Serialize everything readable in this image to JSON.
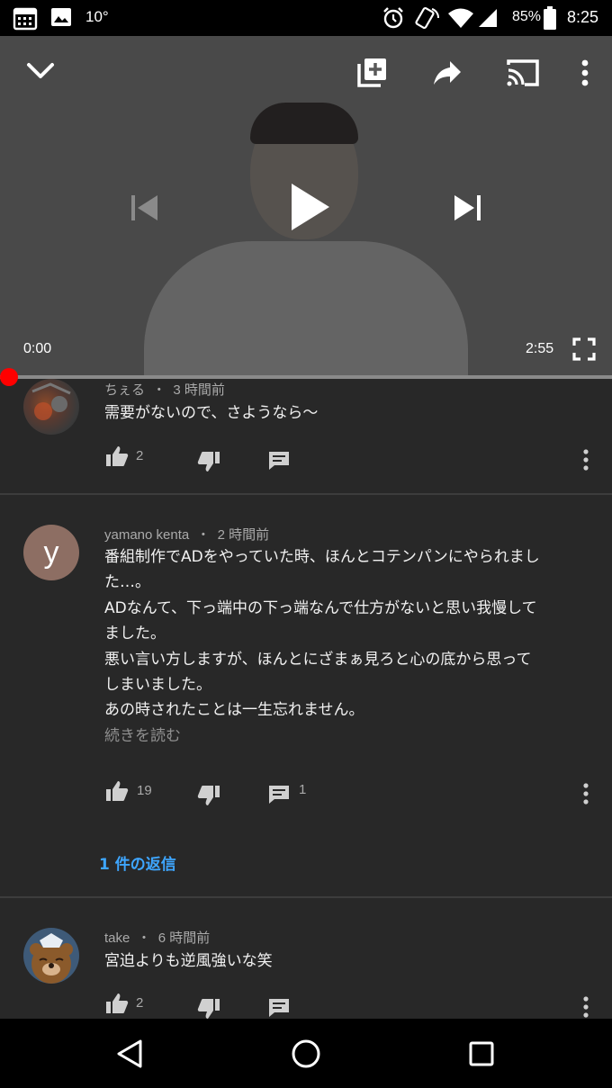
{
  "status_bar": {
    "temperature": "10°",
    "battery": "85%",
    "time": "8:25",
    "icons": [
      "calendar-icon",
      "image-icon",
      "alarm-icon",
      "rotate-icon",
      "wifi-icon",
      "signal-icon",
      "battery-icon"
    ]
  },
  "player": {
    "current_time": "0:00",
    "duration": "2:55",
    "progress": 0,
    "icons": [
      "chevron-down-icon",
      "add-to-playlist-icon",
      "share-icon",
      "cast-icon",
      "more-vert-icon",
      "previous-icon",
      "play-icon",
      "next-icon",
      "fullscreen-icon"
    ]
  },
  "comments": [
    {
      "author": "ちぇる",
      "time_ago": "3 時間前",
      "lines": [
        "需要がないので、さようなら〜"
      ],
      "likes": "2",
      "replies_count": ""
    },
    {
      "author": "yamano kenta",
      "avatar_letter": "y",
      "time_ago": "2 時間前",
      "lines": [
        "番組制作でADをやっていた時、ほんとコテンパンにやられまし",
        "た…。",
        "ADなんて、下っ端中の下っ端なんで仕方がないと思い我慢して",
        "ました。",
        "悪い言い方しますが、ほんとにざまぁ見ろと心の底から思って",
        "しまいました。",
        "あの時されたことは一生忘れません。"
      ],
      "read_more": "続きを読む",
      "likes": "19",
      "replies_count": "1",
      "replies_link": "1 件の返信"
    },
    {
      "author": "take",
      "time_ago": "6 時間前",
      "lines": [
        "宮迫よりも逆風強いな笑"
      ],
      "likes": "2",
      "replies_count": ""
    }
  ],
  "separator": "・",
  "colors": {
    "progress": "#ff0000",
    "link": "#3ea6ff",
    "background": "#282828"
  },
  "nav_icons": [
    "back-icon",
    "home-icon",
    "recents-icon"
  ]
}
